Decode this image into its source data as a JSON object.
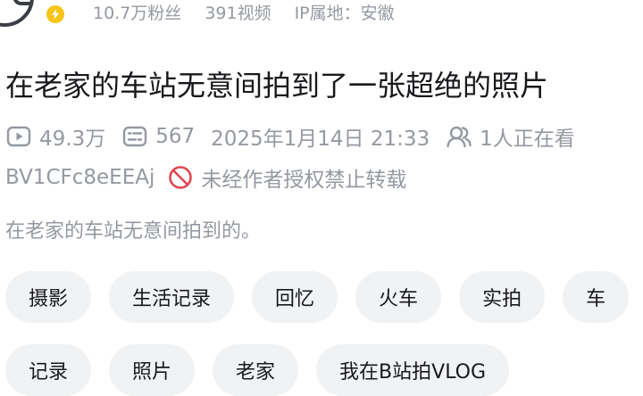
{
  "author": {
    "followers": "10.7万粉丝",
    "videos": "391视频",
    "ip_location": "IP属地：安徽"
  },
  "video": {
    "title": "在老家的车站无意间拍到了一张超绝的照片",
    "views": "49.3万",
    "danmaku": "567",
    "publish_time": "2025年1月14日 21:33",
    "watching_now": "1人正在看",
    "bvid": "BV1CFc8eEEAj",
    "copyright_notice": "未经作者授权禁止转载",
    "description": "在老家的车站无意间拍到的。"
  },
  "tags_row1": [
    "摄影",
    "生活记录",
    "回忆",
    "火车",
    "实拍",
    "车"
  ],
  "tags_row2": [
    "记录",
    "照片",
    "老家",
    "我在B站拍VLOG"
  ],
  "colors": {
    "text_primary": "#18191c",
    "text_secondary": "#9499a0",
    "tag_bg": "#f1f2f3",
    "badge_yellow": "#f5c518",
    "ban_red": "#e0464f"
  }
}
